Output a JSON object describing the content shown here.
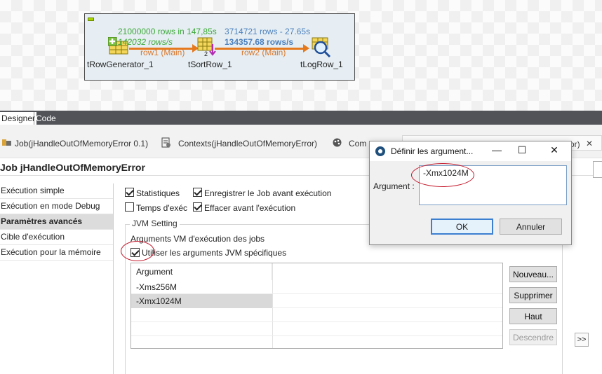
{
  "designer": {
    "components": {
      "generator": "tRowGenerator_1",
      "sort": "tSortRow_1",
      "log": "tLogRow_1"
    },
    "flows": {
      "row1": {
        "stats_line1": "21000000 rows in 147,85s",
        "stats_line2": "142032 rows/s",
        "label": "row1 (Main)"
      },
      "row2": {
        "stats_line1": "3714721 rows - 27.65s",
        "stats_line2": "134357.68 rows/s",
        "label": "row2 (Main)"
      }
    }
  },
  "editor_tabs": {
    "designer": "Designer",
    "code": "Code"
  },
  "view_tabs": {
    "job": "Job(jHandleOutOfMemoryError 0.1)",
    "contexts": "Contexts(jHandleOutOfMemoryError)",
    "component": "Com",
    "partial": "or)"
  },
  "page_title": "Job jHandleOutOfMemoryError",
  "left_nav": [
    {
      "label": "Exécution simple",
      "selected": false
    },
    {
      "label": "Exécution en mode Debug",
      "selected": false
    },
    {
      "label": "Paramètres avancés",
      "selected": true
    },
    {
      "label": "Cible d'exécution",
      "selected": false
    },
    {
      "label": "Exécution pour la mémoire",
      "selected": false
    }
  ],
  "options": {
    "statistics": {
      "label": "Statistiques",
      "checked": true
    },
    "save_job": {
      "label": "Enregistrer le Job avant exécution",
      "checked": true
    },
    "exec_time": {
      "label": "Temps d'exéc",
      "checked": false
    },
    "clear_before": {
      "label": "Effacer avant l'exécution",
      "checked": true
    }
  },
  "jvm": {
    "group_title": "JVM Setting",
    "vm_args_label": "Arguments VM d'exécution des jobs",
    "use_specific": {
      "label": "Utiliser les arguments JVM spécifiques",
      "checked": true
    },
    "table_header": "Argument",
    "arguments": [
      {
        "value": "-Xms256M",
        "selected": false
      },
      {
        "value": "-Xmx1024M",
        "selected": true
      }
    ],
    "buttons": {
      "new": "Nouveau...",
      "delete": "Supprimer",
      "up": "Haut",
      "down": "Descendre"
    }
  },
  "more_button": ">>",
  "dialog": {
    "title": "Définir les argument...",
    "label": "Argument :",
    "value": "-Xmx1024M",
    "ok": "OK",
    "cancel": "Annuler",
    "minimize": "—",
    "maximize": "☐",
    "close": "✕"
  },
  "colors": {
    "flow": "#e5791e",
    "stats_green": "#3da839",
    "stats_blue": "#4c80bd",
    "annotation": "#c4182b",
    "tab_strip": "#515358"
  }
}
